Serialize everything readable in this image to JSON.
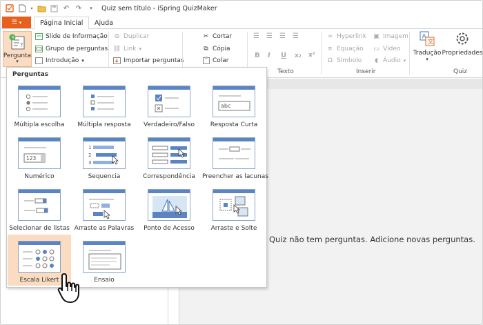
{
  "window": {
    "title": "Quiz sem título - iSpring QuizMaker"
  },
  "file_button": {
    "label": "☰"
  },
  "tabs": [
    {
      "label": "Página Inicial"
    },
    {
      "label": "Ajuda"
    }
  ],
  "ribbon": {
    "pergunta": {
      "label": "Pergunta"
    },
    "slide_info": "Slide de Informação",
    "grupo": "Grupo de perguntas",
    "intro": "Introdução",
    "duplicar": "Duplicar",
    "link": "Link",
    "importar": "Importar perguntas",
    "cortar": "Cortar",
    "copia": "Cópia",
    "colar": "Colar",
    "format_bold": "B",
    "format_italic": "I",
    "format_underline": "U",
    "format_sub": "x₂",
    "format_sup": "x²",
    "hyperlink": "Hyperlink",
    "equacao": "Equação",
    "simbolo": "Símbolo",
    "imagem": "Imagem",
    "video": "Vídeo",
    "audio": "Áudio",
    "traducao": "Tradução",
    "propriedades": "Propriedades",
    "groups": {
      "texto": "Texto",
      "inserir": "Inserir",
      "quiz": "Quiz"
    }
  },
  "dropdown": {
    "title": "Perguntas",
    "items": [
      {
        "label": "Múltipla escolha"
      },
      {
        "label": "Múltipla resposta"
      },
      {
        "label": "Verdadeiro/Falso"
      },
      {
        "label": "Resposta Curta",
        "thumb_text": "abc"
      },
      {
        "label": "Numérico",
        "thumb_text": "123"
      },
      {
        "label": "Sequencia",
        "thumb_text": "1 2 3"
      },
      {
        "label": "Correspondência"
      },
      {
        "label": "Preencher as lacunas"
      },
      {
        "label": "Selecionar de listas"
      },
      {
        "label": "Arraste as Palavras"
      },
      {
        "label": "Ponto de Acesso"
      },
      {
        "label": "Arraste e Solte"
      },
      {
        "label": "Escala Likert"
      },
      {
        "label": "Ensaio"
      }
    ]
  },
  "main": {
    "empty_message": "Quiz não tem perguntas. Adicione novas perguntas."
  },
  "colors": {
    "accent": "#e8601c",
    "highlight": "#fadcc2",
    "thumb_blue": "#5b84c4"
  }
}
